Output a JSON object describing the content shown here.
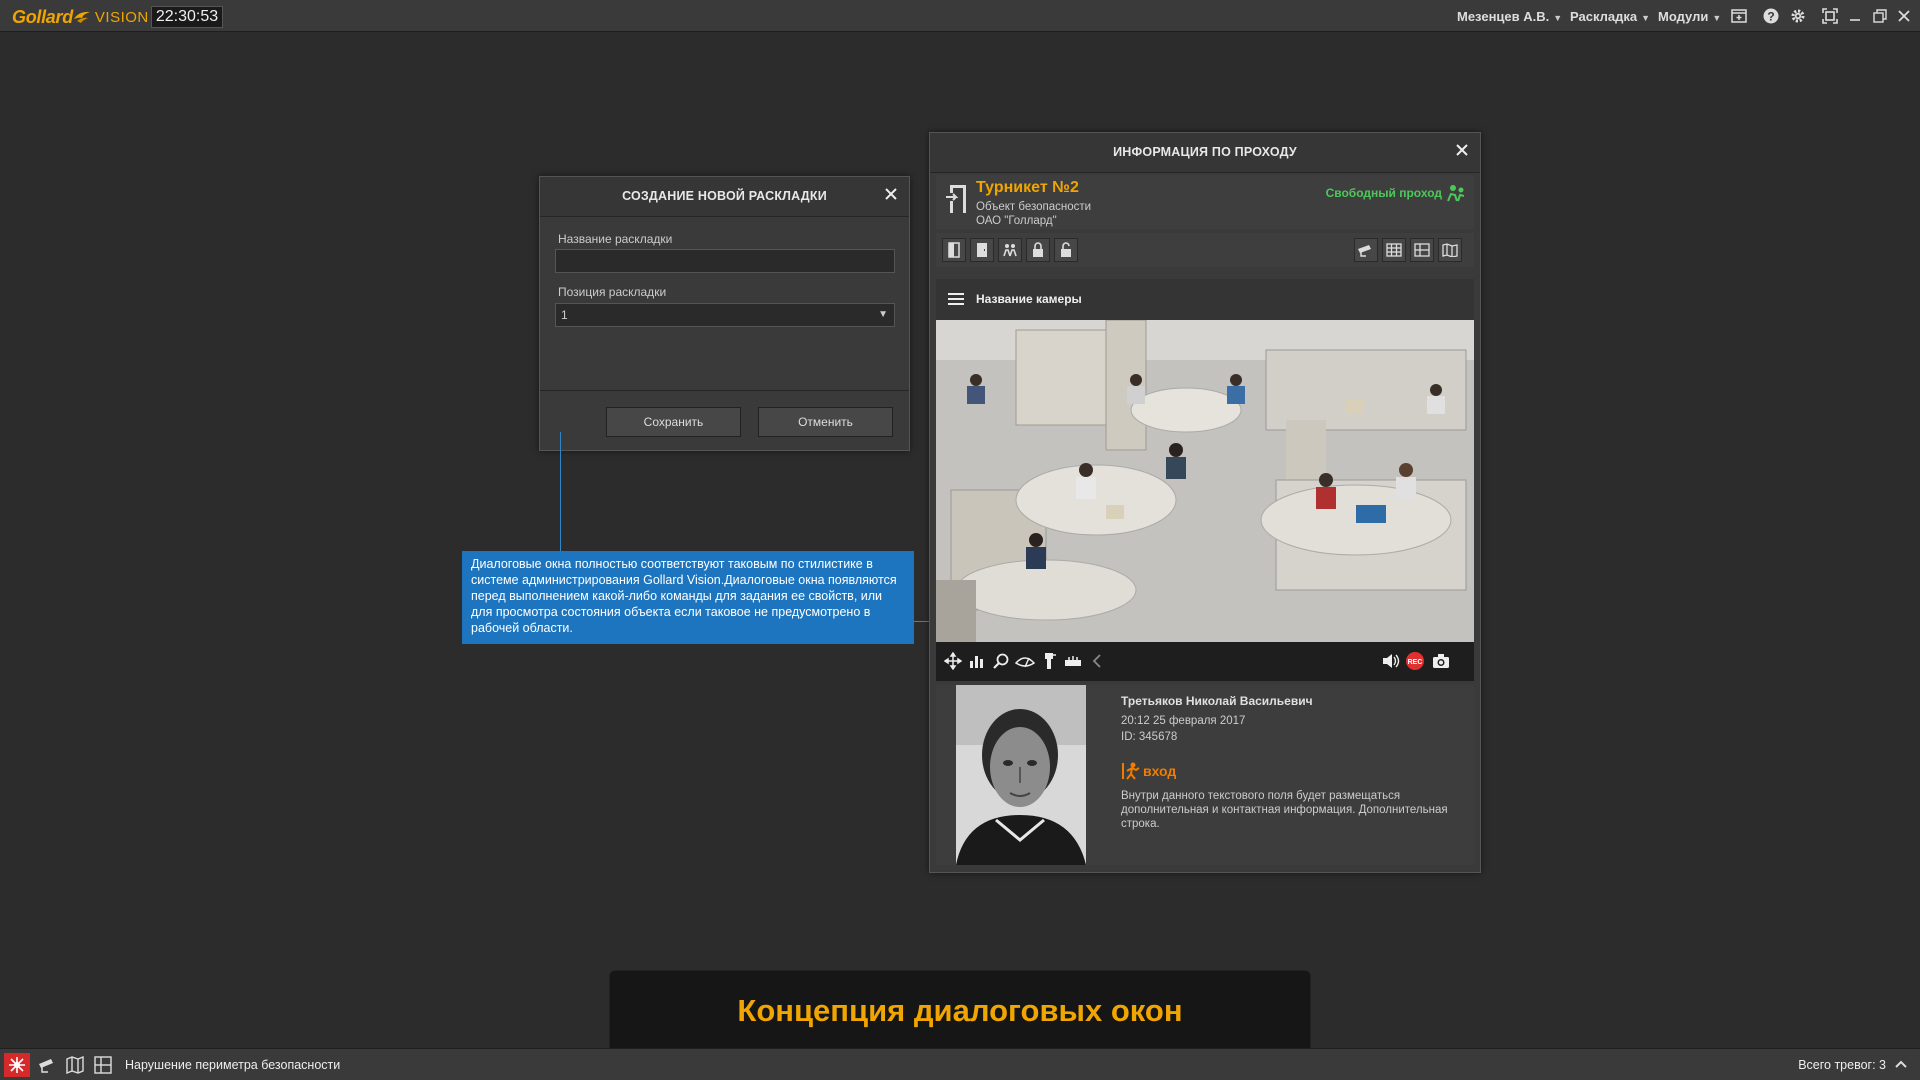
{
  "topbar": {
    "logo_brand": "Gollard",
    "logo_suffix": "VISION",
    "clock": "22:30:53",
    "user_menu": "Мезенцев А.В.",
    "layout_menu": "Раскладка",
    "modules_menu": "Модули"
  },
  "new_layout_dialog": {
    "title": "СОЗДАНИЕ НОВОЙ РАСКЛАДКИ",
    "name_label": "Название раскладки",
    "name_value": "",
    "position_label": "Позиция раскладки",
    "position_value": "1",
    "save_label": "Сохранить",
    "cancel_label": "Отменить"
  },
  "info_dialog": {
    "title": "ИНФОРМАЦИЯ ПО ПРОХОДУ",
    "object_title": "Турникет №2",
    "object_sub1": "Объект безопасности",
    "object_sub2": "ОАО \"Голлард\"",
    "status": "Свободный проход",
    "status_color": "#4cc85a",
    "camera_name": "Название камеры",
    "person": {
      "name": "Третьяков Николай Васильевич",
      "time": "20:12   25 февраля 2017",
      "id": "ID: 345678",
      "direction": "вход",
      "info": "Внутри данного текстового поля будет размещаться дополнительная и контактная информация. Дополнительная строка."
    }
  },
  "callout": {
    "text": "Диалоговые окна полностью соответствуют таковым по стилистике в системе администрирования Gollard Vision.Диалоговые окна появляются перед выполнением какой-либо команды для задания ее свойств, или для просмотра состояния объекта если таковое не предусмотрено в рабочей области."
  },
  "caption": {
    "text": "Концепция диалоговых окон"
  },
  "statusbar": {
    "message": "Нарушение периметра безопасности",
    "total_alarms": "Всего тревог: 3"
  },
  "colors": {
    "accent": "#f0a500",
    "callout": "#1d75c0",
    "alarm": "#d62a2a",
    "entry": "#f07c00"
  }
}
